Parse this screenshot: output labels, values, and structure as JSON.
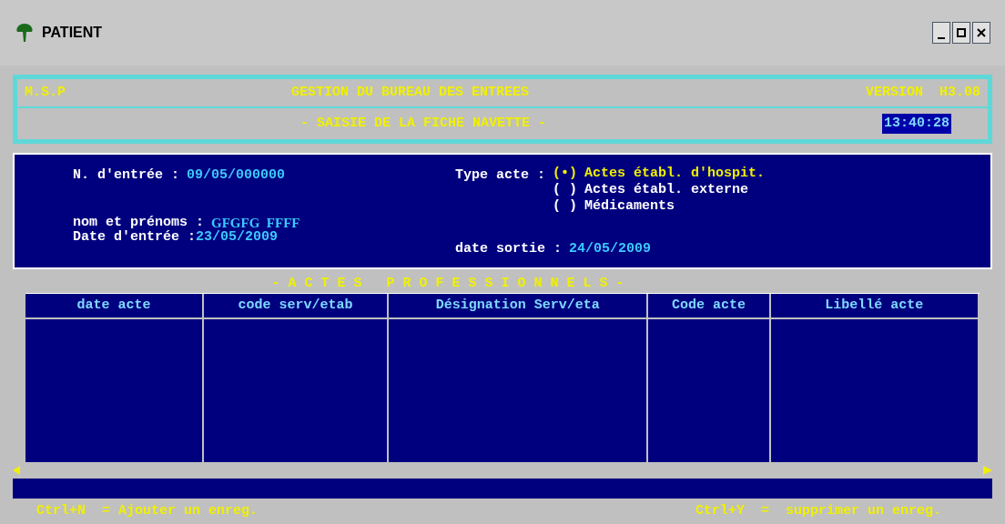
{
  "window": {
    "title": "PATIENT"
  },
  "header": {
    "left": "M.S.P",
    "title": "GESTION DU BUREAU DES ENTREES",
    "version": "VERSION  H3.08",
    "subtitle": "- SAISIE DE LA FICHE NAVETTE -",
    "clock": "13:40:28"
  },
  "form": {
    "entry_label": "N. d'entrée :",
    "entry_value": "09/05/000000",
    "name_label": "nom et prénoms :",
    "name_value": "GFGFG  FFFF",
    "date_in_label": "Date d'entrée :",
    "date_in_value": "23/05/2009",
    "type_label": "Type acte :",
    "date_out_label": "date sortie :",
    "date_out_value": "24/05/2009",
    "type_options": [
      {
        "mark": "(•)",
        "label": "Actes établ. d'hospit.",
        "selected": true
      },
      {
        "mark": "( )",
        "label": "Actes établ. externe",
        "selected": false
      },
      {
        "mark": "( )",
        "label": "Médicaments",
        "selected": false
      }
    ]
  },
  "table": {
    "title": "- A C T E S   P R O F E S S I O N N E L S -",
    "columns": [
      "date acte",
      "code serv/etab",
      "Désignation Serv/eta",
      "Code acte",
      "Libellé acte"
    ]
  },
  "status_bar": {
    "left": "Ctrl+N  = Ajouter un enreg.",
    "right": "Ctrl+Y  =  supprimer un enreg."
  }
}
